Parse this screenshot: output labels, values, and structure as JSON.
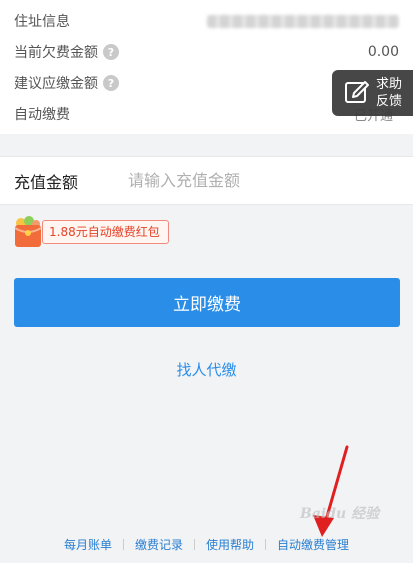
{
  "info": {
    "address_label": "住址信息",
    "arrears_label": "当前欠费金额",
    "arrears_value": "0.00",
    "suggested_label": "建议应缴金额",
    "auto_pay_label": "自动缴费",
    "auto_pay_status": "已开通"
  },
  "feedback": {
    "line1": "求助",
    "line2": "反馈"
  },
  "recharge": {
    "label": "充值金额",
    "placeholder": "请输入充值金额"
  },
  "red_packet": {
    "text": "1.88元自动缴费红包"
  },
  "pay_button": {
    "label": "立即缴费"
  },
  "proxy_pay": {
    "label": "找人代缴"
  },
  "bottom_nav": {
    "items": [
      "每月账单",
      "缴费记录",
      "使用帮助",
      "自动缴费管理"
    ]
  },
  "watermark": {
    "text": "Baidu 经验"
  },
  "colors": {
    "accent": "#2a8ee8",
    "red_packet": "#e4432a",
    "annotation_arrow": "#e02020"
  }
}
